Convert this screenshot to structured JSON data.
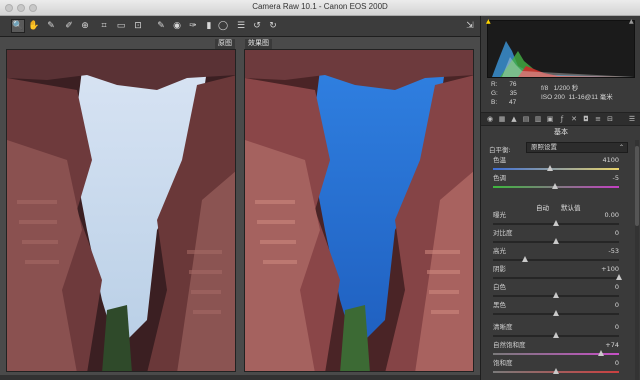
{
  "window": {
    "title": "Camera Raw 10.1 - Canon EOS 200D"
  },
  "toolbar": {
    "tools": [
      {
        "name": "zoom-tool",
        "glyph": "🔍"
      },
      {
        "name": "hand-tool",
        "glyph": "✋"
      },
      {
        "name": "white-balance-tool",
        "glyph": "✎"
      },
      {
        "name": "color-sampler-tool",
        "glyph": "✐"
      },
      {
        "name": "targeted-adjustment-tool",
        "glyph": "⊕"
      },
      {
        "name": "crop-tool",
        "glyph": "⌗"
      },
      {
        "name": "straighten-tool",
        "glyph": "▭"
      },
      {
        "name": "transform-tool",
        "glyph": "⊡"
      },
      {
        "name": "spot-removal-tool",
        "glyph": "✎"
      },
      {
        "name": "red-eye-tool",
        "glyph": "◉"
      },
      {
        "name": "adjustment-brush-tool",
        "glyph": "✑"
      },
      {
        "name": "graduated-filter-tool",
        "glyph": "▮"
      },
      {
        "name": "radial-filter-tool",
        "glyph": "◯"
      },
      {
        "name": "preferences-tool",
        "glyph": "☰"
      },
      {
        "name": "rotate-left-tool",
        "glyph": "↺"
      },
      {
        "name": "rotate-right-tool",
        "glyph": "↻"
      }
    ],
    "export_glyph": "⇲"
  },
  "view": {
    "before_label": "原图",
    "after_label": "效果图"
  },
  "info": {
    "r_label": "R:",
    "r_value": "76",
    "g_label": "G:",
    "g_value": "35",
    "b_label": "B:",
    "b_value": "47",
    "aperture": "f/8",
    "shutter": "1/200 秒",
    "iso": "ISO 200",
    "lens": "11-16@11 毫米"
  },
  "panel": {
    "title": "基本",
    "wb_label": "白平衡:",
    "wb_value": "原照设置",
    "auto": "自动",
    "default": "默认值",
    "sliders": [
      {
        "label": "色温",
        "value": "4100",
        "pos": 0.45
      },
      {
        "label": "色调",
        "value": "-5",
        "pos": 0.49
      },
      {
        "label": "曝光",
        "value": "0.00",
        "pos": 0.5
      },
      {
        "label": "对比度",
        "value": "0",
        "pos": 0.5
      },
      {
        "label": "高光",
        "value": "-53",
        "pos": 0.25
      },
      {
        "label": "阴影",
        "value": "+100",
        "pos": 1.0
      },
      {
        "label": "白色",
        "value": "0",
        "pos": 0.5
      },
      {
        "label": "黑色",
        "value": "0",
        "pos": 0.5
      },
      {
        "label": "清晰度",
        "value": "0",
        "pos": 0.5
      },
      {
        "label": "自然饱和度",
        "value": "+74",
        "pos": 0.86
      },
      {
        "label": "饱和度",
        "value": "0",
        "pos": 0.5
      }
    ]
  }
}
